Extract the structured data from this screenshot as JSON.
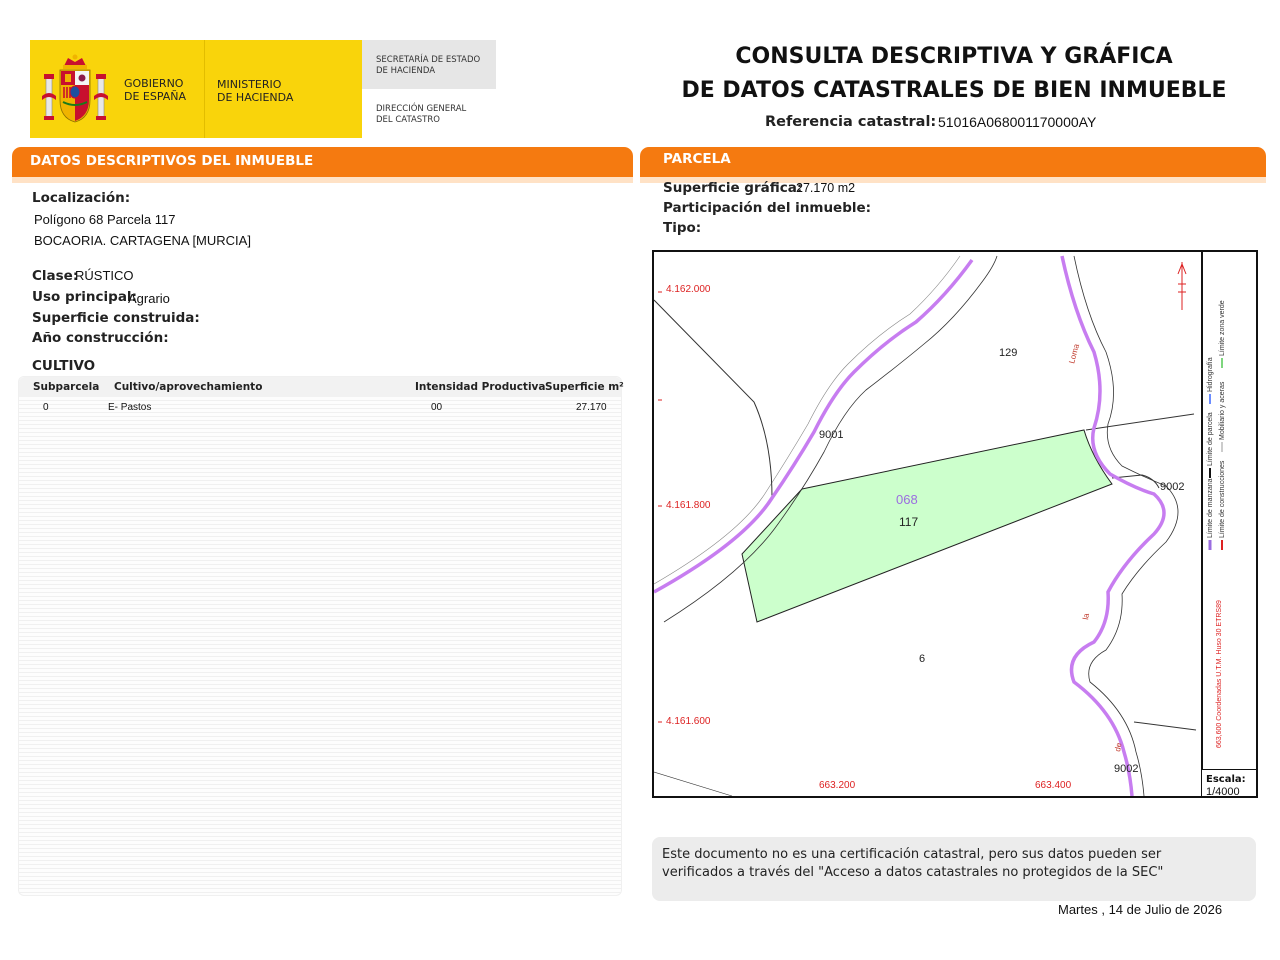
{
  "gov": {
    "gobierno": "GOBIERNO\nDE ESPAÑA",
    "ministerio": "MINISTERIO\nDE HACIENDA",
    "secretaria": "SECRETARÍA DE ESTADO\nDE HACIENDA",
    "direccion": "DIRECCIÓN GENERAL\nDEL CATASTRO"
  },
  "title": {
    "line1": "CONSULTA DESCRIPTIVA Y GRÁFICA",
    "line2": "DE DATOS CATASTRALES DE BIEN INMUEBLE",
    "ref_label": "Referencia catastral:",
    "ref_value": "51016A068001170000AY"
  },
  "left_section": {
    "header": "DATOS DESCRIPTIVOS DEL INMUEBLE",
    "localizacion_label": "Localización:",
    "localizacion_line1": "Polígono 68 Parcela 117",
    "localizacion_line2": "BOCAORIA. CARTAGENA [MURCIA]",
    "clase_label": "Clase:",
    "clase_value": "RÚSTICO",
    "uso_label": "Uso principal:",
    "uso_value": "Agrario",
    "superficie_label": "Superficie construida:",
    "ano_label": "Año construcción:",
    "cultivo_label": "CULTIVO",
    "cultivo_table": {
      "headers": [
        "Subparcela",
        "Cultivo/aprovechamiento",
        "Intensidad Productiva",
        "Superficie m²"
      ],
      "rows": [
        [
          "0",
          "E- Pastos",
          "00",
          "27.170"
        ]
      ]
    }
  },
  "right_section": {
    "header": "PARCELA",
    "superficie_label": "Superficie gráfica:",
    "superficie_value": "27.170 m2",
    "participacion_label": "Participación del inmueble:",
    "tipo_label": "Tipo:"
  },
  "map": {
    "y_coords": [
      "4.162.000",
      "4.161.800",
      "4.161.600"
    ],
    "x_coords": [
      "663.200",
      "663.400"
    ],
    "labels": {
      "parcel_129": "129",
      "parcel_9001": "9001",
      "parcel_9002_a": "9002",
      "parcel_9002_b": "9002",
      "poligono": "068",
      "parcel_117": "117",
      "parcel_6": "6",
      "road_a": "Loma",
      "road_b": "la",
      "road_c": "de"
    },
    "legend": {
      "col1": [
        "Límite de manzana",
        "Límite de parcela",
        "Hidrografía"
      ],
      "col2": [
        "Límite de construcciones",
        "Mobiliario y aceras",
        "Límite zona verde"
      ],
      "coords_note": "663,600 Coordenadas U.T.M. Huso 30 ETRS89"
    },
    "scale_label": "Escala:",
    "scale_value": "1/4000",
    "colors": {
      "parcel_fill": "#ccffcc",
      "road_line": "#c77df0",
      "coord_text": "#dd2222"
    }
  },
  "notice": {
    "text": "Este documento no es una certificación catastral, pero sus datos pueden ser verificados a través del \"Acceso a datos catastrales no protegidos de la SEC\""
  },
  "date": "Martes , 14 de Julio de 2026"
}
